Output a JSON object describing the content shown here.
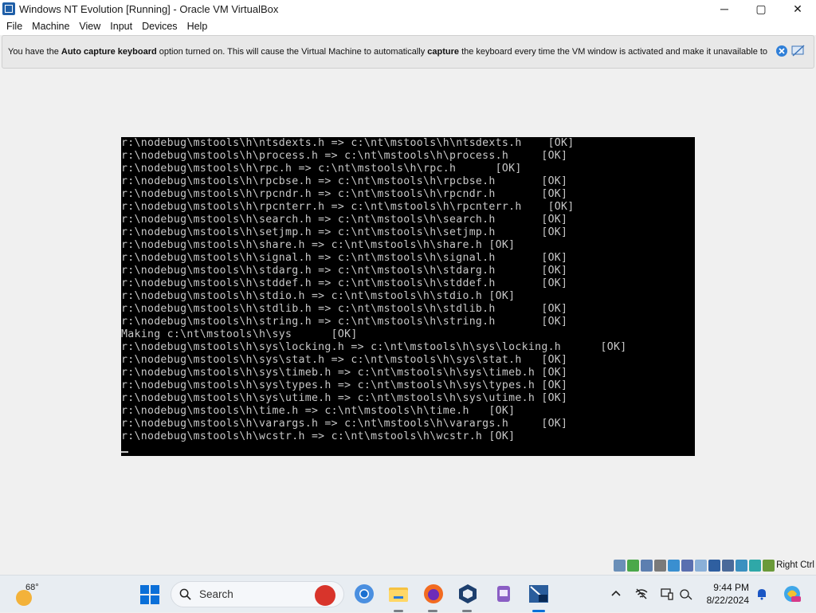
{
  "window": {
    "title": "Windows NT Evolution [Running] - Oracle VM VirtualBox",
    "controls": [
      "─",
      "▢",
      "✕"
    ]
  },
  "menu": [
    "File",
    "Machine",
    "View",
    "Input",
    "Devices",
    "Help"
  ],
  "notice": {
    "part1": "You have the ",
    "bold1": "Auto capture keyboard",
    "part2": " option turned on. This will cause the Virtual Machine to automatically ",
    "bold2": "capture",
    "part3": " the keyboard every time the VM window is activated and make it unavailable to"
  },
  "console": {
    "lines": [
      "r:\\nodebug\\mstools\\h\\ntsdexts.h => c:\\nt\\mstools\\h\\ntsdexts.h    [OK]",
      "r:\\nodebug\\mstools\\h\\process.h => c:\\nt\\mstools\\h\\process.h     [OK]",
      "r:\\nodebug\\mstools\\h\\rpc.h => c:\\nt\\mstools\\h\\rpc.h      [OK]",
      "r:\\nodebug\\mstools\\h\\rpcbse.h => c:\\nt\\mstools\\h\\rpcbse.h       [OK]",
      "r:\\nodebug\\mstools\\h\\rpcndr.h => c:\\nt\\mstools\\h\\rpcndr.h       [OK]",
      "r:\\nodebug\\mstools\\h\\rpcnterr.h => c:\\nt\\mstools\\h\\rpcnterr.h    [OK]",
      "r:\\nodebug\\mstools\\h\\search.h => c:\\nt\\mstools\\h\\search.h       [OK]",
      "r:\\nodebug\\mstools\\h\\setjmp.h => c:\\nt\\mstools\\h\\setjmp.h       [OK]",
      "r:\\nodebug\\mstools\\h\\share.h => c:\\nt\\mstools\\h\\share.h [OK]",
      "r:\\nodebug\\mstools\\h\\signal.h => c:\\nt\\mstools\\h\\signal.h       [OK]",
      "r:\\nodebug\\mstools\\h\\stdarg.h => c:\\nt\\mstools\\h\\stdarg.h       [OK]",
      "r:\\nodebug\\mstools\\h\\stddef.h => c:\\nt\\mstools\\h\\stddef.h       [OK]",
      "r:\\nodebug\\mstools\\h\\stdio.h => c:\\nt\\mstools\\h\\stdio.h [OK]",
      "r:\\nodebug\\mstools\\h\\stdlib.h => c:\\nt\\mstools\\h\\stdlib.h       [OK]",
      "r:\\nodebug\\mstools\\h\\string.h => c:\\nt\\mstools\\h\\string.h       [OK]",
      "Making c:\\nt\\mstools\\h\\sys      [OK]",
      "r:\\nodebug\\mstools\\h\\sys\\locking.h => c:\\nt\\mstools\\h\\sys\\locking.h      [OK]",
      "r:\\nodebug\\mstools\\h\\sys\\stat.h => c:\\nt\\mstools\\h\\sys\\stat.h   [OK]",
      "r:\\nodebug\\mstools\\h\\sys\\timeb.h => c:\\nt\\mstools\\h\\sys\\timeb.h [OK]",
      "r:\\nodebug\\mstools\\h\\sys\\types.h => c:\\nt\\mstools\\h\\sys\\types.h [OK]",
      "r:\\nodebug\\mstools\\h\\sys\\utime.h => c:\\nt\\mstools\\h\\sys\\utime.h [OK]",
      "r:\\nodebug\\mstools\\h\\time.h => c:\\nt\\mstools\\h\\time.h   [OK]",
      "r:\\nodebug\\mstools\\h\\varargs.h => c:\\nt\\mstools\\h\\varargs.h     [OK]",
      "r:\\nodebug\\mstools\\h\\wcstr.h => c:\\nt\\mstools\\h\\wcstr.h [OK]"
    ]
  },
  "statusbar": {
    "host_key": "Right Ctrl",
    "icons": [
      "hard-disk-icon",
      "optical-drive-icon",
      "floppy-icon",
      "audio-icon",
      "network-icon",
      "usb-icon",
      "shared-folder-icon",
      "display-icon",
      "recording-icon",
      "cpu-icon",
      "mouse-integration-icon",
      "keyboard-icon"
    ]
  },
  "taskbar": {
    "weather_temp": "68°",
    "search_placeholder": "Search",
    "time": "9:44 PM",
    "date": "8/22/2024"
  },
  "colors": {
    "console_bg": "#000000",
    "console_fg": "#c8c8c8",
    "accent": "#0a6fd8"
  }
}
